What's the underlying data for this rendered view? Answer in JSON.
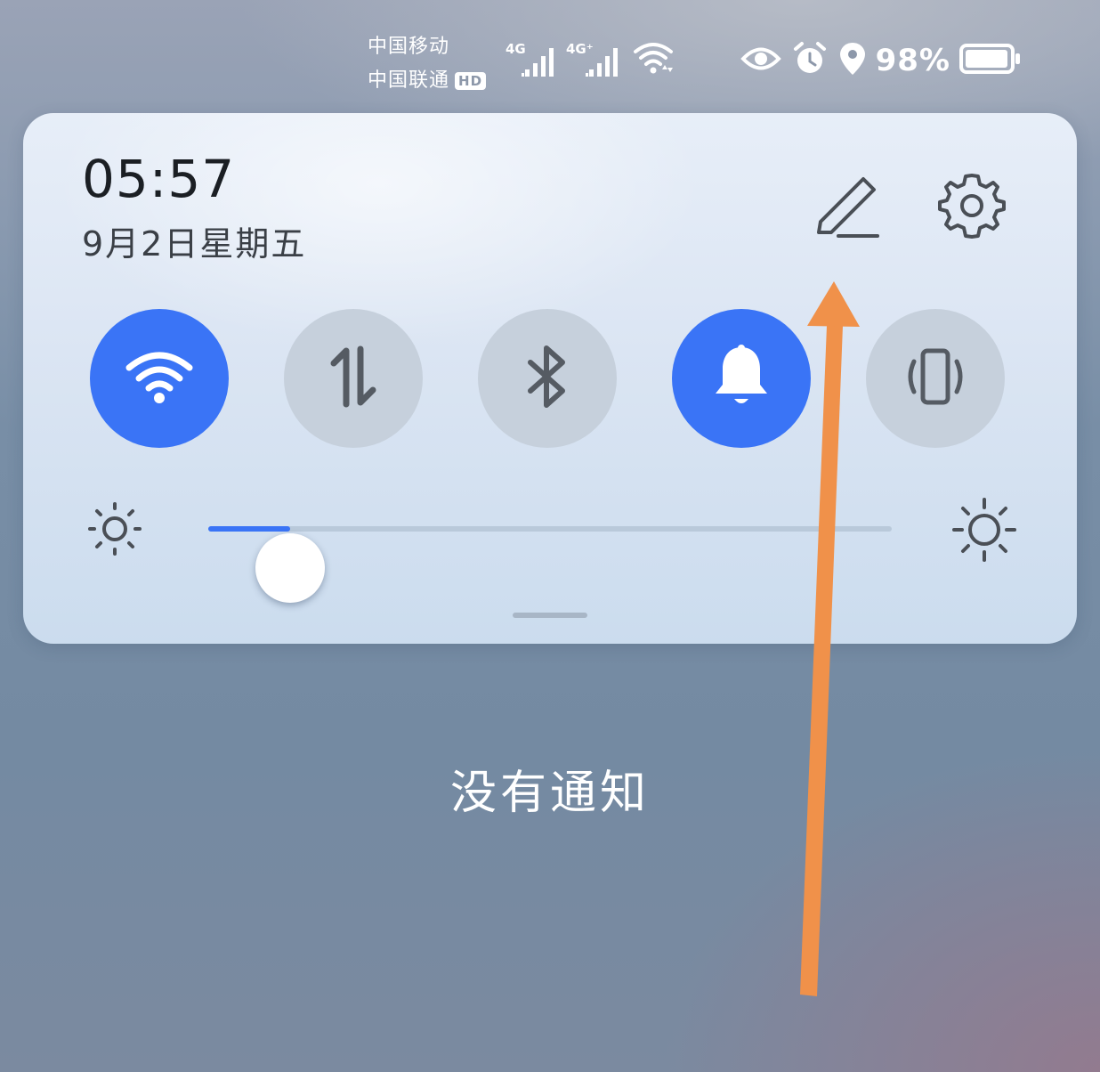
{
  "status_bar": {
    "carrier_1": "中国移动",
    "carrier_2": "中国联通",
    "hd_badge": "HD",
    "sim1_network": "4G",
    "sim2_network": "4G⁺",
    "battery_percent": "98%",
    "battery_level": 0.98,
    "icons": [
      "eye-icon",
      "alarm-icon",
      "location-icon",
      "battery-icon",
      "wifi-status-icon",
      "signal-icon"
    ]
  },
  "panel": {
    "time": "05:57",
    "date": "9月2日星期五",
    "edit_icon": "pencil-edit-icon",
    "settings_icon": "gear-icon",
    "toggles": [
      {
        "name": "wifi",
        "icon": "wifi-icon",
        "active": true
      },
      {
        "name": "mobile-data",
        "icon": "data-arrows-icon",
        "active": false
      },
      {
        "name": "bluetooth",
        "icon": "bluetooth-icon",
        "active": false
      },
      {
        "name": "sound",
        "icon": "bell-icon",
        "active": true
      },
      {
        "name": "vibrate",
        "icon": "vibrate-icon",
        "active": false
      }
    ],
    "brightness": {
      "level": 0.12,
      "low_icon": "brightness-low-icon",
      "high_icon": "brightness-high-icon"
    }
  },
  "notifications": {
    "empty_text": "没有通知"
  },
  "annotation": {
    "arrow_color": "#f0914a"
  },
  "colors": {
    "accent": "#3a74f6",
    "toggle_off": "#c6d0dc"
  }
}
